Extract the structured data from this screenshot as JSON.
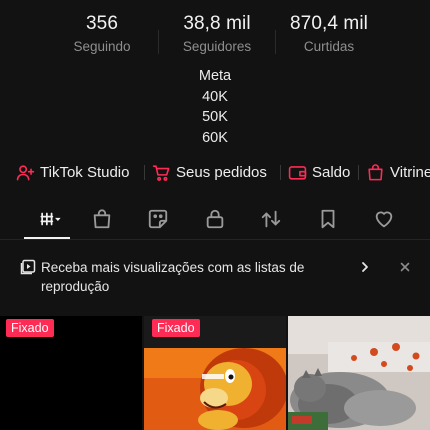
{
  "stats": {
    "following": {
      "value": "356",
      "label": "Seguindo"
    },
    "followers": {
      "value": "38,8 mil",
      "label": "Seguidores"
    },
    "likes": {
      "value": "870,4 mil",
      "label": "Curtidas"
    }
  },
  "bio": {
    "lines": [
      "Meta",
      "40K",
      "50K",
      "60K"
    ]
  },
  "links": [
    {
      "label": "TikTok Studio",
      "icon": "user-plus-icon"
    },
    {
      "label": "Seus pedidos",
      "icon": "cart-icon"
    },
    {
      "label": "Saldo",
      "icon": "wallet-icon"
    },
    {
      "label": "Vitrine",
      "icon": "shopping-bag-icon"
    }
  ],
  "tabs": [
    {
      "icon": "grid-icon",
      "active": true
    },
    {
      "icon": "shopping-bag-icon"
    },
    {
      "icon": "sticker-icon"
    },
    {
      "icon": "lock-icon"
    },
    {
      "icon": "repost-icon"
    },
    {
      "icon": "bookmark-icon"
    },
    {
      "icon": "heart-icon"
    }
  ],
  "banner": {
    "text": "Receba mais visualizações com as listas de reprodução"
  },
  "grid": {
    "pinned_label": "Fixado"
  },
  "colors": {
    "background": "#121212",
    "accent": "#fe2c55",
    "icon_accent": "#fe2c55"
  }
}
